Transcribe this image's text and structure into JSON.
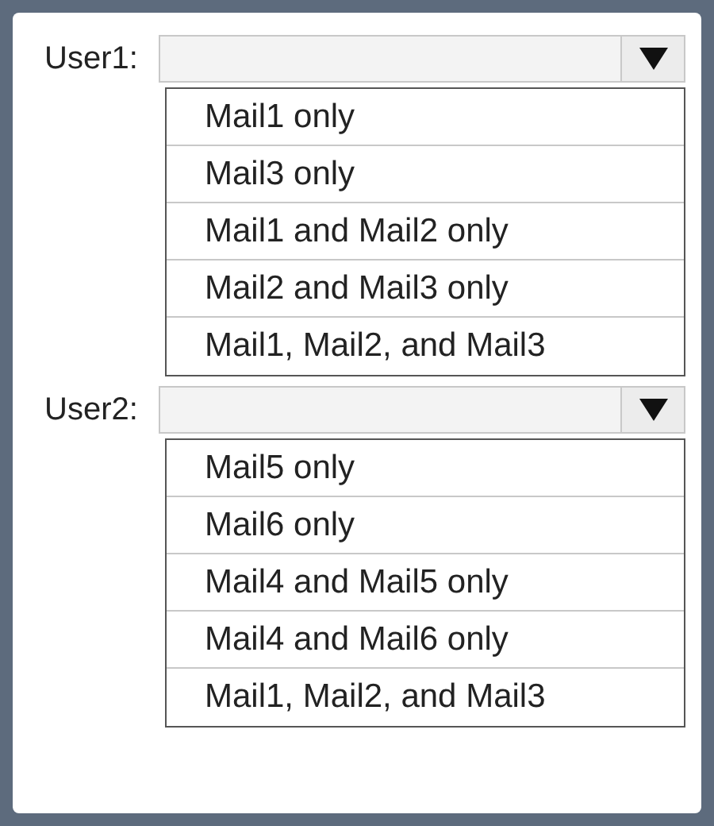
{
  "groups": [
    {
      "label": "User1:",
      "options": [
        "Mail1 only",
        "Mail3 only",
        "Mail1 and Mail2 only",
        "Mail2 and Mail3 only",
        "Mail1, Mail2, and Mail3"
      ]
    },
    {
      "label": "User2:",
      "options": [
        "Mail5 only",
        "Mail6 only",
        "Mail4 and Mail5 only",
        "Mail4 and Mail6 only",
        "Mail1, Mail2, and Mail3"
      ]
    }
  ]
}
